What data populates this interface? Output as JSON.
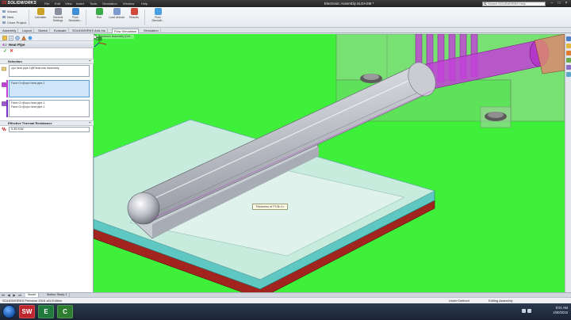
{
  "app": {
    "logo_prefix": "3S",
    "logo_text": "SOLIDWORKS",
    "document_title": "Electronic Assembly.SLDASM *",
    "search_placeholder": "Search SOLIDWORKS Help",
    "menus": [
      "File",
      "Edit",
      "View",
      "Insert",
      "Tools",
      "Simulation",
      "Window",
      "Help"
    ]
  },
  "command_manager": {
    "left_items": [
      "Wizard",
      "New",
      "Clone Project"
    ],
    "big_buttons": [
      {
        "label": "Calculate",
        "icon": "calculate-icon",
        "color": "#c9a227"
      },
      {
        "label": "General Settings",
        "icon": "general-settings-icon",
        "color": "#8a8fa0"
      },
      {
        "label": "Flow Simulatio...",
        "icon": "flow-simulation-icon",
        "color": "#3f8fd6"
      },
      {
        "label": "Run",
        "icon": "run-icon",
        "color": "#3cab4c"
      },
      {
        "label": "Load Unload",
        "icon": "load-results-icon",
        "color": "#7d9ccf"
      },
      {
        "label": "Results",
        "icon": "results-icon",
        "color": "#d14b3c"
      },
      {
        "label": "Flow Simulati...",
        "icon": "flow-sim-options-icon",
        "color": "#4aa0e0"
      }
    ]
  },
  "tabs": [
    "Assembly",
    "Layout",
    "Sketch",
    "Evaluate",
    "SOLIDWORKS Add-Ins",
    "Flow Simulation",
    "Simulation"
  ],
  "active_tab": "Flow Simulation",
  "viewport": {
    "breadcrumb": "Electronic Assembly (Def...",
    "tooltip": "Thickness of PCB<1>"
  },
  "property_manager": {
    "title": "Heat Pipe",
    "selection_header": "Selection",
    "selection_component": "cpu heat pipe-1@Electronic Assembly",
    "faces_group_1": [
      "Face<1>@cpu heat pipe-1"
    ],
    "faces_group_2": [
      "Face<2>@cpu heat pipe-1",
      "Face<3>@cpu heat pipe-1"
    ],
    "thermal_header": "Effective Thermal Resistance",
    "thermal_value": "0.35 K/W"
  },
  "bottom_tabs": [
    "Model",
    "Motion Study 1"
  ],
  "active_bottom_tab": "Model",
  "status": {
    "edition": "SOLIDWORKS Premium 2015 x64 Edition",
    "state": "Under Defined",
    "mode": "Editing Assembly"
  },
  "taskbar": {
    "apps": [
      {
        "label": "SW",
        "icon": "solidworks-taskbar-icon",
        "color": "#c0262d"
      },
      {
        "label": "E",
        "icon": "excel-taskbar-icon",
        "color": "#1f7a3b"
      },
      {
        "label": "C",
        "icon": "camtasia-taskbar-icon",
        "color": "#2f7d2f"
      }
    ],
    "time": "9:01 AM",
    "date": "4/30/2015"
  },
  "colors": {
    "viewport_bg": "#3ef03a",
    "selection_magenta": "#c23fd8",
    "pcb_teal": "#5ec7c2",
    "pcb_red": "#a1241e"
  }
}
